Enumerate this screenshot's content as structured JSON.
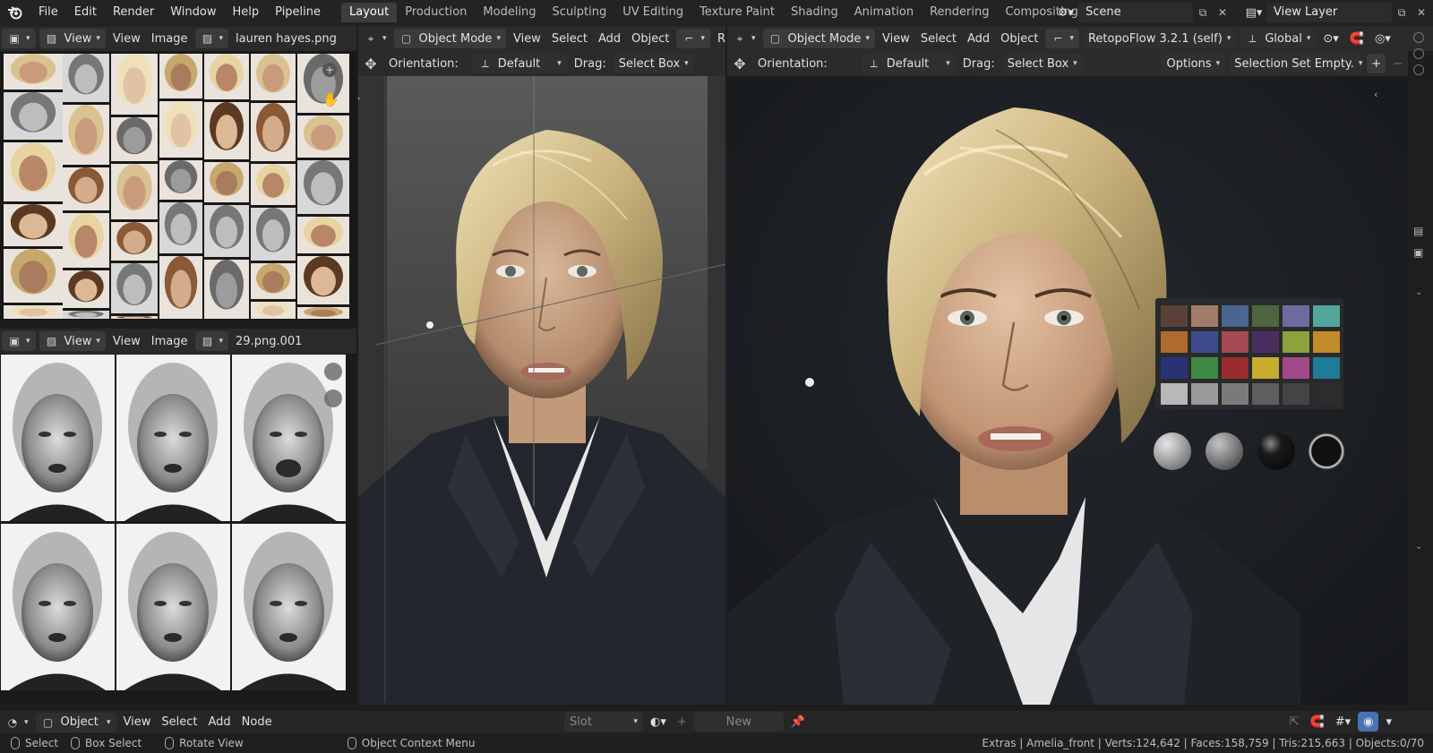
{
  "topbar": {
    "menus": [
      "File",
      "Edit",
      "Render",
      "Window",
      "Help",
      "Pipeline"
    ],
    "workspaces": [
      "Layout",
      "Production",
      "Modeling",
      "Sculpting",
      "UV Editing",
      "Texture Paint",
      "Shading",
      "Animation",
      "Rendering",
      "Compositing",
      "Ge"
    ],
    "active_workspace": "Layout",
    "scene_label": "Scene",
    "view_layer_label": "View Layer"
  },
  "image_editor_top": {
    "view_label": "View",
    "view2_label": "View",
    "image_label": "Image",
    "image_name": "lauren hayes.png"
  },
  "image_editor_bottom": {
    "view_label": "View",
    "view2_label": "View",
    "image_label": "Image",
    "image_name": "29.png.001"
  },
  "viewport_left": {
    "mode": "Object Mode",
    "menus": [
      "View",
      "Select",
      "Add",
      "Object"
    ],
    "extra": "Ret",
    "orientation_label": "Orientation:",
    "orientation_value": "Default",
    "drag_label": "Drag:",
    "drag_value": "Select Box"
  },
  "viewport_right": {
    "mode": "Object Mode",
    "menus": [
      "View",
      "Select",
      "Add",
      "Object"
    ],
    "addon": "RetopoFlow 3.2.1 (self)",
    "transform": "Global",
    "orientation_label": "Orientation:",
    "orientation_value": "Default",
    "drag_label": "Drag:",
    "drag_value": "Select Box",
    "options_label": "Options",
    "selection_set": "Selection Set Empty."
  },
  "node_editor": {
    "type_value": "Object",
    "menus": [
      "View",
      "Select",
      "Add",
      "Node"
    ],
    "slot_label": "Slot",
    "new_label": "New"
  },
  "statusbar": {
    "select_label": "Select",
    "box_select_label": "Box Select",
    "rotate_label": "Rotate View",
    "context_menu_label": "Object Context Menu",
    "stats": "Extras | Amelia_front | Verts:124,642 | Faces:158,759 | Tris:215,663 | Objects:0/70"
  },
  "colors": {
    "accent_blue": "#4772b3",
    "header_bg": "#2a2a2a",
    "active_tab": "#3d3d3d"
  }
}
